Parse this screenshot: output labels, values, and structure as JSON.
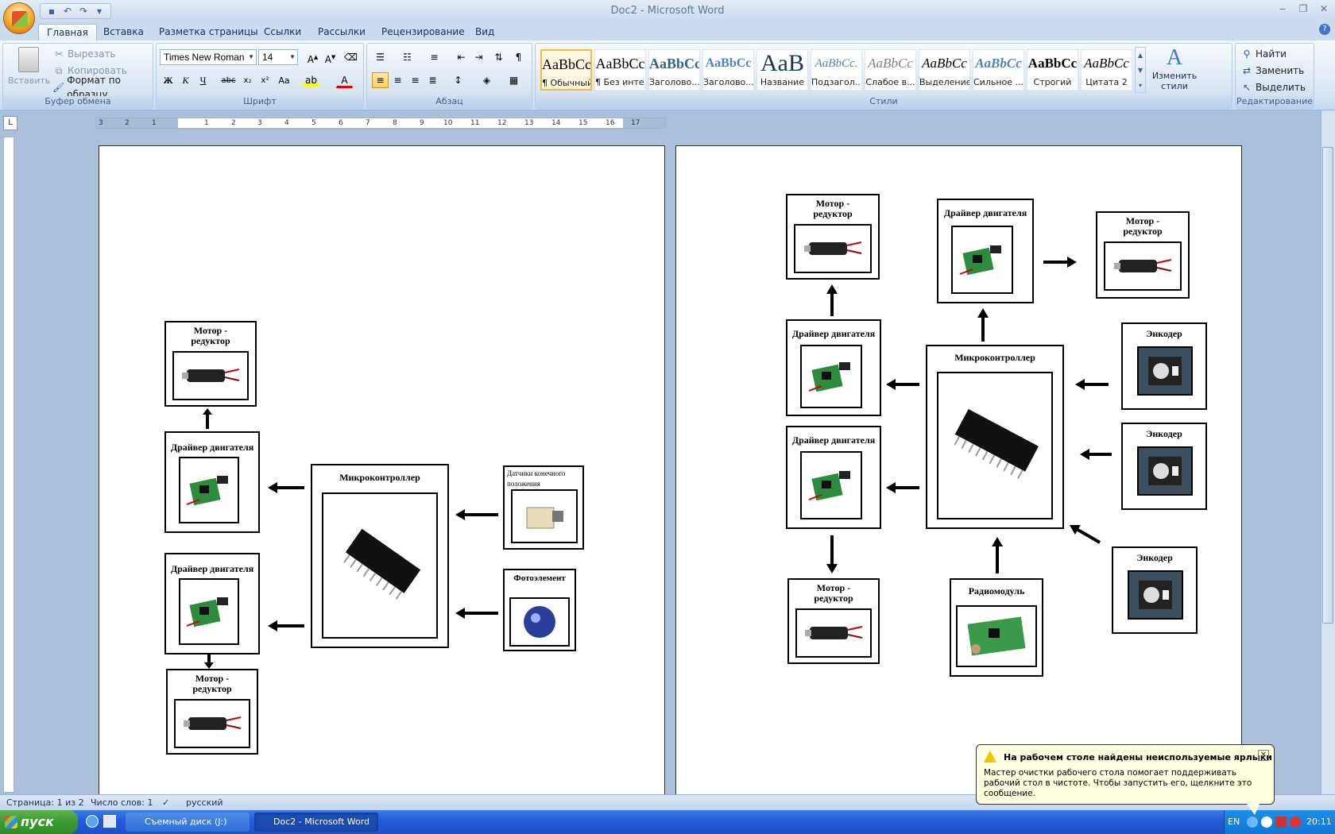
{
  "window": {
    "title": "Doc2 - Microsoft Word"
  },
  "qat": {
    "icons": [
      "save-icon",
      "undo-icon",
      "redo-icon",
      "customize-icon"
    ]
  },
  "tabs": [
    "Главная",
    "Вставка",
    "Разметка страницы",
    "Ссылки",
    "Рассылки",
    "Рецензирование",
    "Вид"
  ],
  "ribbon": {
    "clipboard": {
      "label": "Буфер обмена",
      "paste": "Вставить",
      "cut": "Вырезать",
      "copy": "Копировать",
      "format_painter": "Формат по образцу"
    },
    "font": {
      "label": "Шрифт",
      "family": "Times New Roman",
      "size": "14"
    },
    "paragraph": {
      "label": "Абзац"
    },
    "styles": {
      "label": "Стили",
      "items": [
        {
          "sample": "AaBbCc",
          "name": "¶ Обычный"
        },
        {
          "sample": "AaBbCc",
          "name": "¶ Без инте..."
        },
        {
          "sample": "AaBbCc",
          "name": "Заголово..."
        },
        {
          "sample": "AaBbCc",
          "name": "Заголово..."
        },
        {
          "sample": "AaB",
          "name": "Название"
        },
        {
          "sample": "AaBbCc.",
          "name": "Подзагол..."
        },
        {
          "sample": "AaBbCc",
          "name": "Слабое в..."
        },
        {
          "sample": "AaBbCc",
          "name": "Выделение"
        },
        {
          "sample": "AaBbCc",
          "name": "Сильное ..."
        },
        {
          "sample": "AaBbCc",
          "name": "Строгий"
        },
        {
          "sample": "AaBbCc",
          "name": "Цитата 2"
        }
      ],
      "change_styles": "Изменить стили"
    },
    "editing": {
      "label": "Редактирование",
      "find": "Найти",
      "replace": "Заменить",
      "select": "Выделить"
    }
  },
  "ruler": {
    "numbers": [
      "3",
      "2",
      "1",
      "1",
      "2",
      "3",
      "4",
      "5",
      "6",
      "7",
      "8",
      "9",
      "10",
      "11",
      "12",
      "13",
      "14",
      "15",
      "16",
      "17"
    ]
  },
  "page1": {
    "motor_top": "Мотор -\nредуктор",
    "driver1": "Драйвер двигателя",
    "driver2": "Драйвер двигателя",
    "motor_bottom": "Мотор -\nредуктор",
    "mcu": "Микроконтроллер",
    "sensor": "Датчики конечного положения",
    "photo": "Фотоэлемент"
  },
  "page2": {
    "motor_tl": "Мотор -\nредуктор",
    "driver_top": "Драйвер двигателя",
    "motor_tr": "Мотор -\nредуктор",
    "driver_l1": "Драйвер двигателя",
    "driver_l2": "Драйвер двигателя",
    "mcu": "Микроконтроллер",
    "enc1": "Энкодер",
    "enc2": "Энкодер",
    "enc3": "Энкодер",
    "motor_bl": "Мотор -\nредуктор",
    "radio": "Радиомодуль"
  },
  "status": {
    "page": "Страница: 1 из 2",
    "words": "Число слов: 1",
    "lang": "русский"
  },
  "taskbar": {
    "start": "пуск",
    "task1": "Съемный диск (J:)",
    "task2": "Doc2 - Microsoft Word",
    "lang": "EN",
    "time": "20:11"
  },
  "balloon": {
    "title": "На рабочем столе найдены неиспользуемые ярлыки",
    "text": "Мастер очистки рабочего стола помогает поддерживать рабочий стол в чистоте. Чтобы запустить его, щелкните это сообщение."
  }
}
